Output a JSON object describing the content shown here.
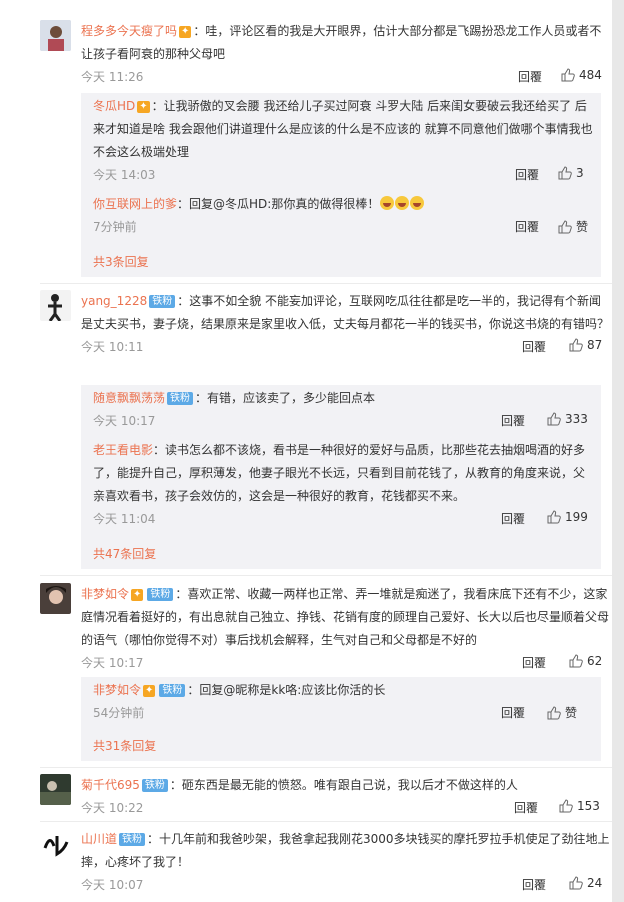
{
  "reply_label": "回覆",
  "c1": {
    "user": "程多多今天瘦了吗",
    "text": "：哇，评论区看的我是大开眼界，估计大部分都是飞踢扮恐龙工作人员或者不让孩子看阿衰的那种父母吧",
    "time": "今天 11:26",
    "likes": "484",
    "replies": [
      {
        "user": "冬瓜HD",
        "text": "：让我骄傲的叉会腰 我还给儿子买过阿衰 斗罗大陆 后来闺女要破云我还给买了 后来才知道是啥  我会跟他们讲道理什么是应该的什么是不应该的  就算不同意他们做哪个事情我也不会这么极端处理",
        "time": "今天 14:03",
        "likes": "3"
      },
      {
        "user": "你互联网上的爹",
        "text": "：回复@冬瓜HD:那你真的做得很棒！",
        "time": "7分钟前",
        "likes": "赞"
      }
    ],
    "more": "共3条回复"
  },
  "c2": {
    "user": "yang_1228",
    "badge": "铁粉",
    "text": "：这事不如全貌 不能妄加评论，互联网吃瓜往往都是吃一半的，我记得有个新闻是丈夫买书，妻子烧，结果原来是家里收入低，丈夫每月都花一半的钱买书，你说这书烧的有错吗？",
    "time": "今天 10:11",
    "likes": "87",
    "replies": [
      {
        "user": "随意飘飘荡荡",
        "badge": "铁粉",
        "text": "：有错，应该卖了，多少能回点本",
        "time": "今天 10:17",
        "likes": "333"
      },
      {
        "user": "老王看电影",
        "text": "：读书怎么都不该烧，看书是一种很好的爱好与品质，比那些花去抽烟喝酒的好多了，能提升自己，厚积薄发，他妻子眼光不长远，只看到目前花钱了，从教育的角度来说，父亲喜欢看书，孩子会效仿的，这会是一种很好的教育，花钱都买不来。",
        "time": "今天 11:04",
        "likes": "199"
      }
    ],
    "more": "共47条回复"
  },
  "c3": {
    "user": "非梦如令",
    "badge": "铁粉",
    "text": "：喜欢正常、收藏一两样也正常、弄一堆就是痴迷了，我看床底下还有不少，这家庭情况看着挺好的，有出息就自己独立、挣钱、花销有度的顾理自己爱好、长大以后也尽量顺着父母的语气（哪怕你觉得不对）事后找机会解释，生气对自己和父母都是不好的",
    "time": "今天 10:17",
    "likes": "62",
    "replies": [
      {
        "user": "非梦如令",
        "badge": "铁粉",
        "text": "：回复@昵称是kk咯:应该比你活的长",
        "time": "54分钟前",
        "likes": "赞"
      }
    ],
    "more": "共31条回复"
  },
  "c4": {
    "user": "菊千代695",
    "badge": "铁粉",
    "text": "：砸东西是最无能的愤怒。唯有跟自己说，我以后才不做这样的人",
    "time": "今天 10:22",
    "likes": "153"
  },
  "c5": {
    "user": "山川道",
    "badge": "铁粉",
    "text": "：十几年前和我爸吵架，我爸拿起我刚花3000多块钱买的摩托罗拉手机使足了劲往地上摔，心疼坏了我了！",
    "time": "今天 10:07",
    "likes": "24"
  },
  "colors": {
    "username": "#eb7350",
    "fan_badge": "#5ca9e6",
    "vip_badge": "#f6a623",
    "sub_bg": "#f2f2f5"
  }
}
